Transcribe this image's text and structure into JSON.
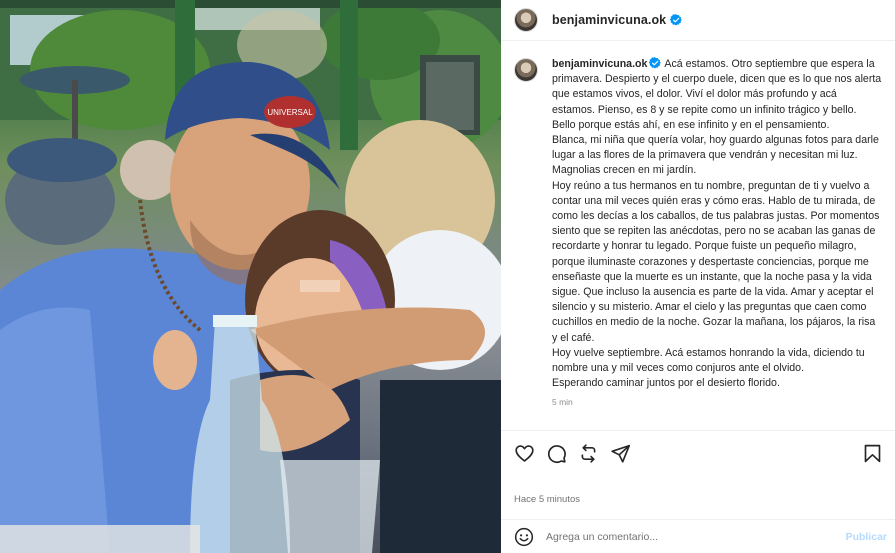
{
  "post": {
    "username": "benjaminvicuna.ok",
    "verified": true,
    "photo_hat_text": "UNIVERSAL",
    "caption_first_line": "Acá estamos. Otro septiembre que espera la primavera. Despierto y el cuerpo duele, dicen que es lo que nos alerta que estamos vivos, el dolor. Viví el dolor más profundo y acá estamos. Pienso, es 8 y se repite como un infinito trágico y bello. Bello porque estás ahí, en ese infinito y en el pensamiento.",
    "caption_paragraphs": [
      "Blanca, mi niña que quería volar, hoy guardo algunas fotos para darle lugar a las flores de la primavera que vendrán y necesitan mi luz. Magnolias crecen en mi jardín.",
      "Hoy reúno a tus hermanos en tu nombre, preguntan de ti y vuelvo a contar una mil veces quién eras y cómo eras. Hablo de tu mirada, de como les decías a los caballos, de tus palabras justas. Por momentos siento que se repiten las anécdotas, pero no se acaban las ganas de recordarte y honrar tu legado. Porque fuiste un pequeño milagro, porque iluminaste corazones y despertaste conciencias, porque me enseñaste que la muerte es un instante, que la noche pasa y la vida sigue. Que incluso la ausencia es parte de la vida. Amar y aceptar el silencio y su misterio. Amar el cielo y las preguntas que caen como cuchillos en medio de la noche. Gozar la mañana, los pájaros, la risa y el café.",
      "Hoy vuelve septiembre. Acá estamos honrando la vida, diciendo tu nombre una y mil veces como conjuros ante el olvido.",
      "Esperando caminar juntos por el desierto florido."
    ],
    "caption_timestamp": "5 min",
    "time_ago": "Hace 5 minutos"
  },
  "actions": {
    "like_icon": "heart-icon",
    "comment_icon": "speech-bubble-icon",
    "repost_icon": "repost-arrows-icon",
    "share_icon": "paper-plane-icon",
    "save_icon": "bookmark-icon"
  },
  "comment_box": {
    "placeholder": "Agrega un comentario...",
    "publish_label": "Publicar",
    "emoji_icon": "smiley-icon"
  },
  "colors": {
    "verified_blue": "#0095f6",
    "publish_disabled": "#b3dbff",
    "muted_text": "#737373",
    "border": "#efefef"
  }
}
